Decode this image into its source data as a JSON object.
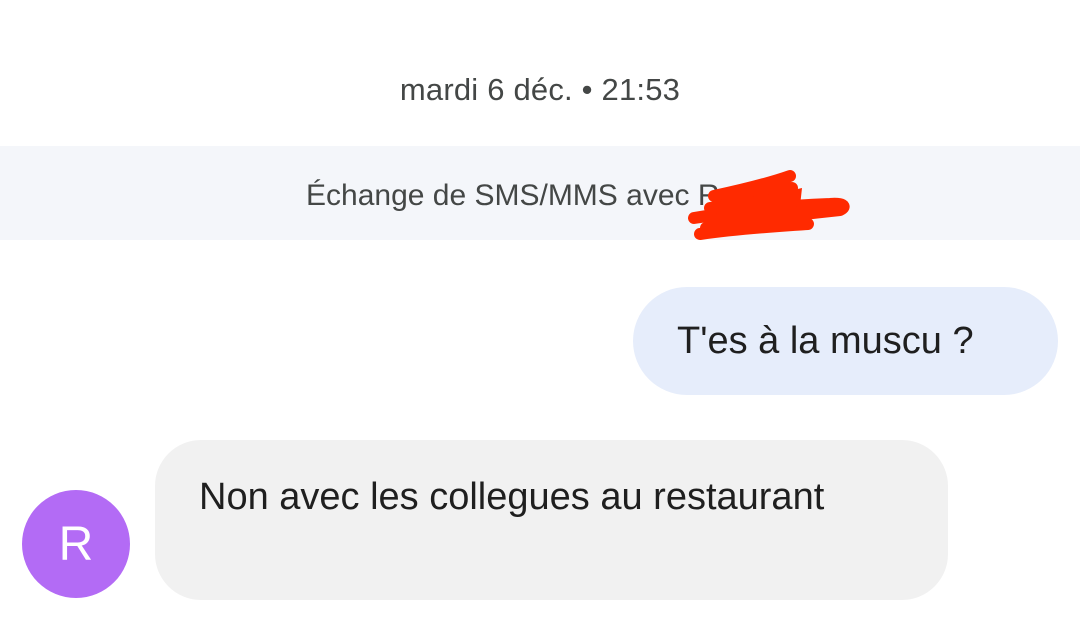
{
  "conversation": {
    "timestamp": "mardi 6 déc. • 21:53",
    "info_banner": "Échange de SMS/MMS avec Roy...",
    "messages": [
      {
        "direction": "outgoing",
        "text": "T'es à la muscu ?"
      },
      {
        "direction": "incoming",
        "sender_initial": "R",
        "text": "Non avec les collegues au restaurant"
      }
    ]
  },
  "colors": {
    "outgoing_bubble": "#e6edfb",
    "incoming_bubble": "#f1f1f1",
    "avatar": "#b36bf5",
    "banner_background": "#f4f6fa",
    "redaction_scribble": "#ff2a00"
  },
  "icons": {
    "redaction": "red-scribble-redaction"
  }
}
